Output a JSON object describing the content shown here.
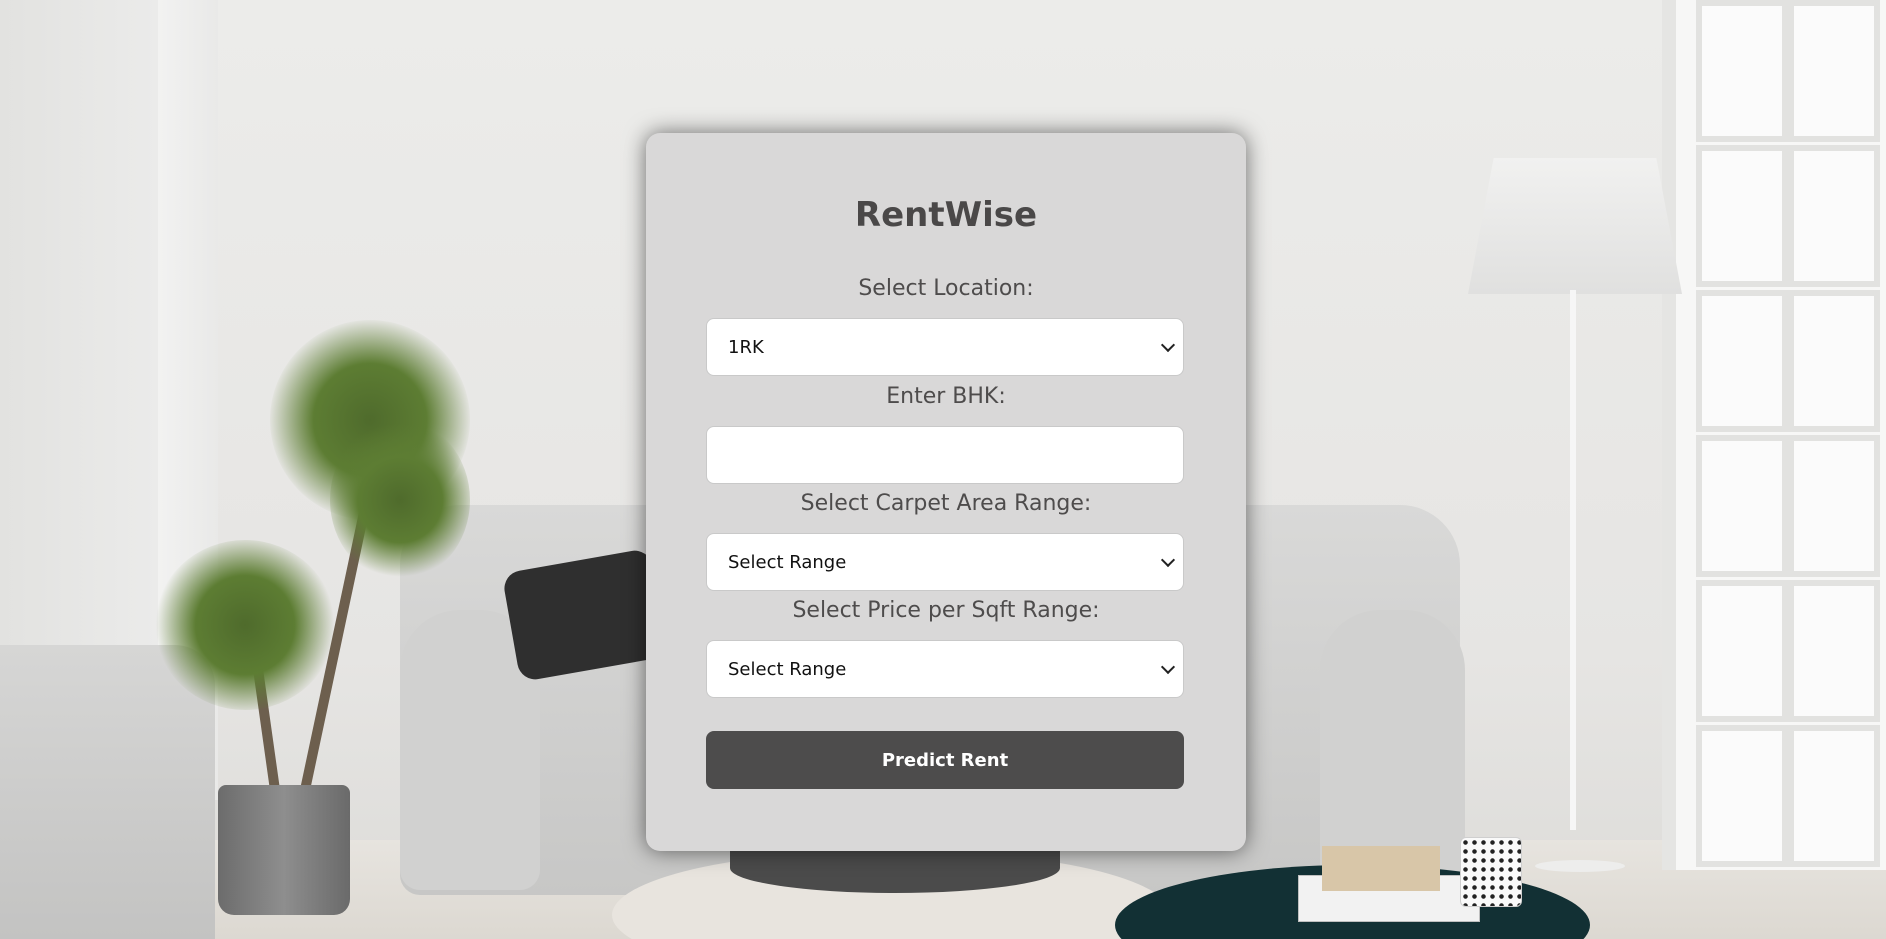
{
  "app": {
    "title": "RentWise"
  },
  "form": {
    "location_label": "Select Location:",
    "location_value": "1RK",
    "bhk_label": "Enter BHK:",
    "bhk_value": "",
    "carpet_label": "Select Carpet Area Range:",
    "carpet_value": "Select Range",
    "price_label": "Select Price per Sqft Range:",
    "price_value": "Select Range",
    "submit_label": "Predict Rent"
  },
  "icons": {
    "dropdown": "chevron-down-icon"
  },
  "colors": {
    "card_bg": "#d9d8d8",
    "title": "#4a4848",
    "button_bg": "#4d4c4c",
    "button_text": "#ffffff"
  }
}
